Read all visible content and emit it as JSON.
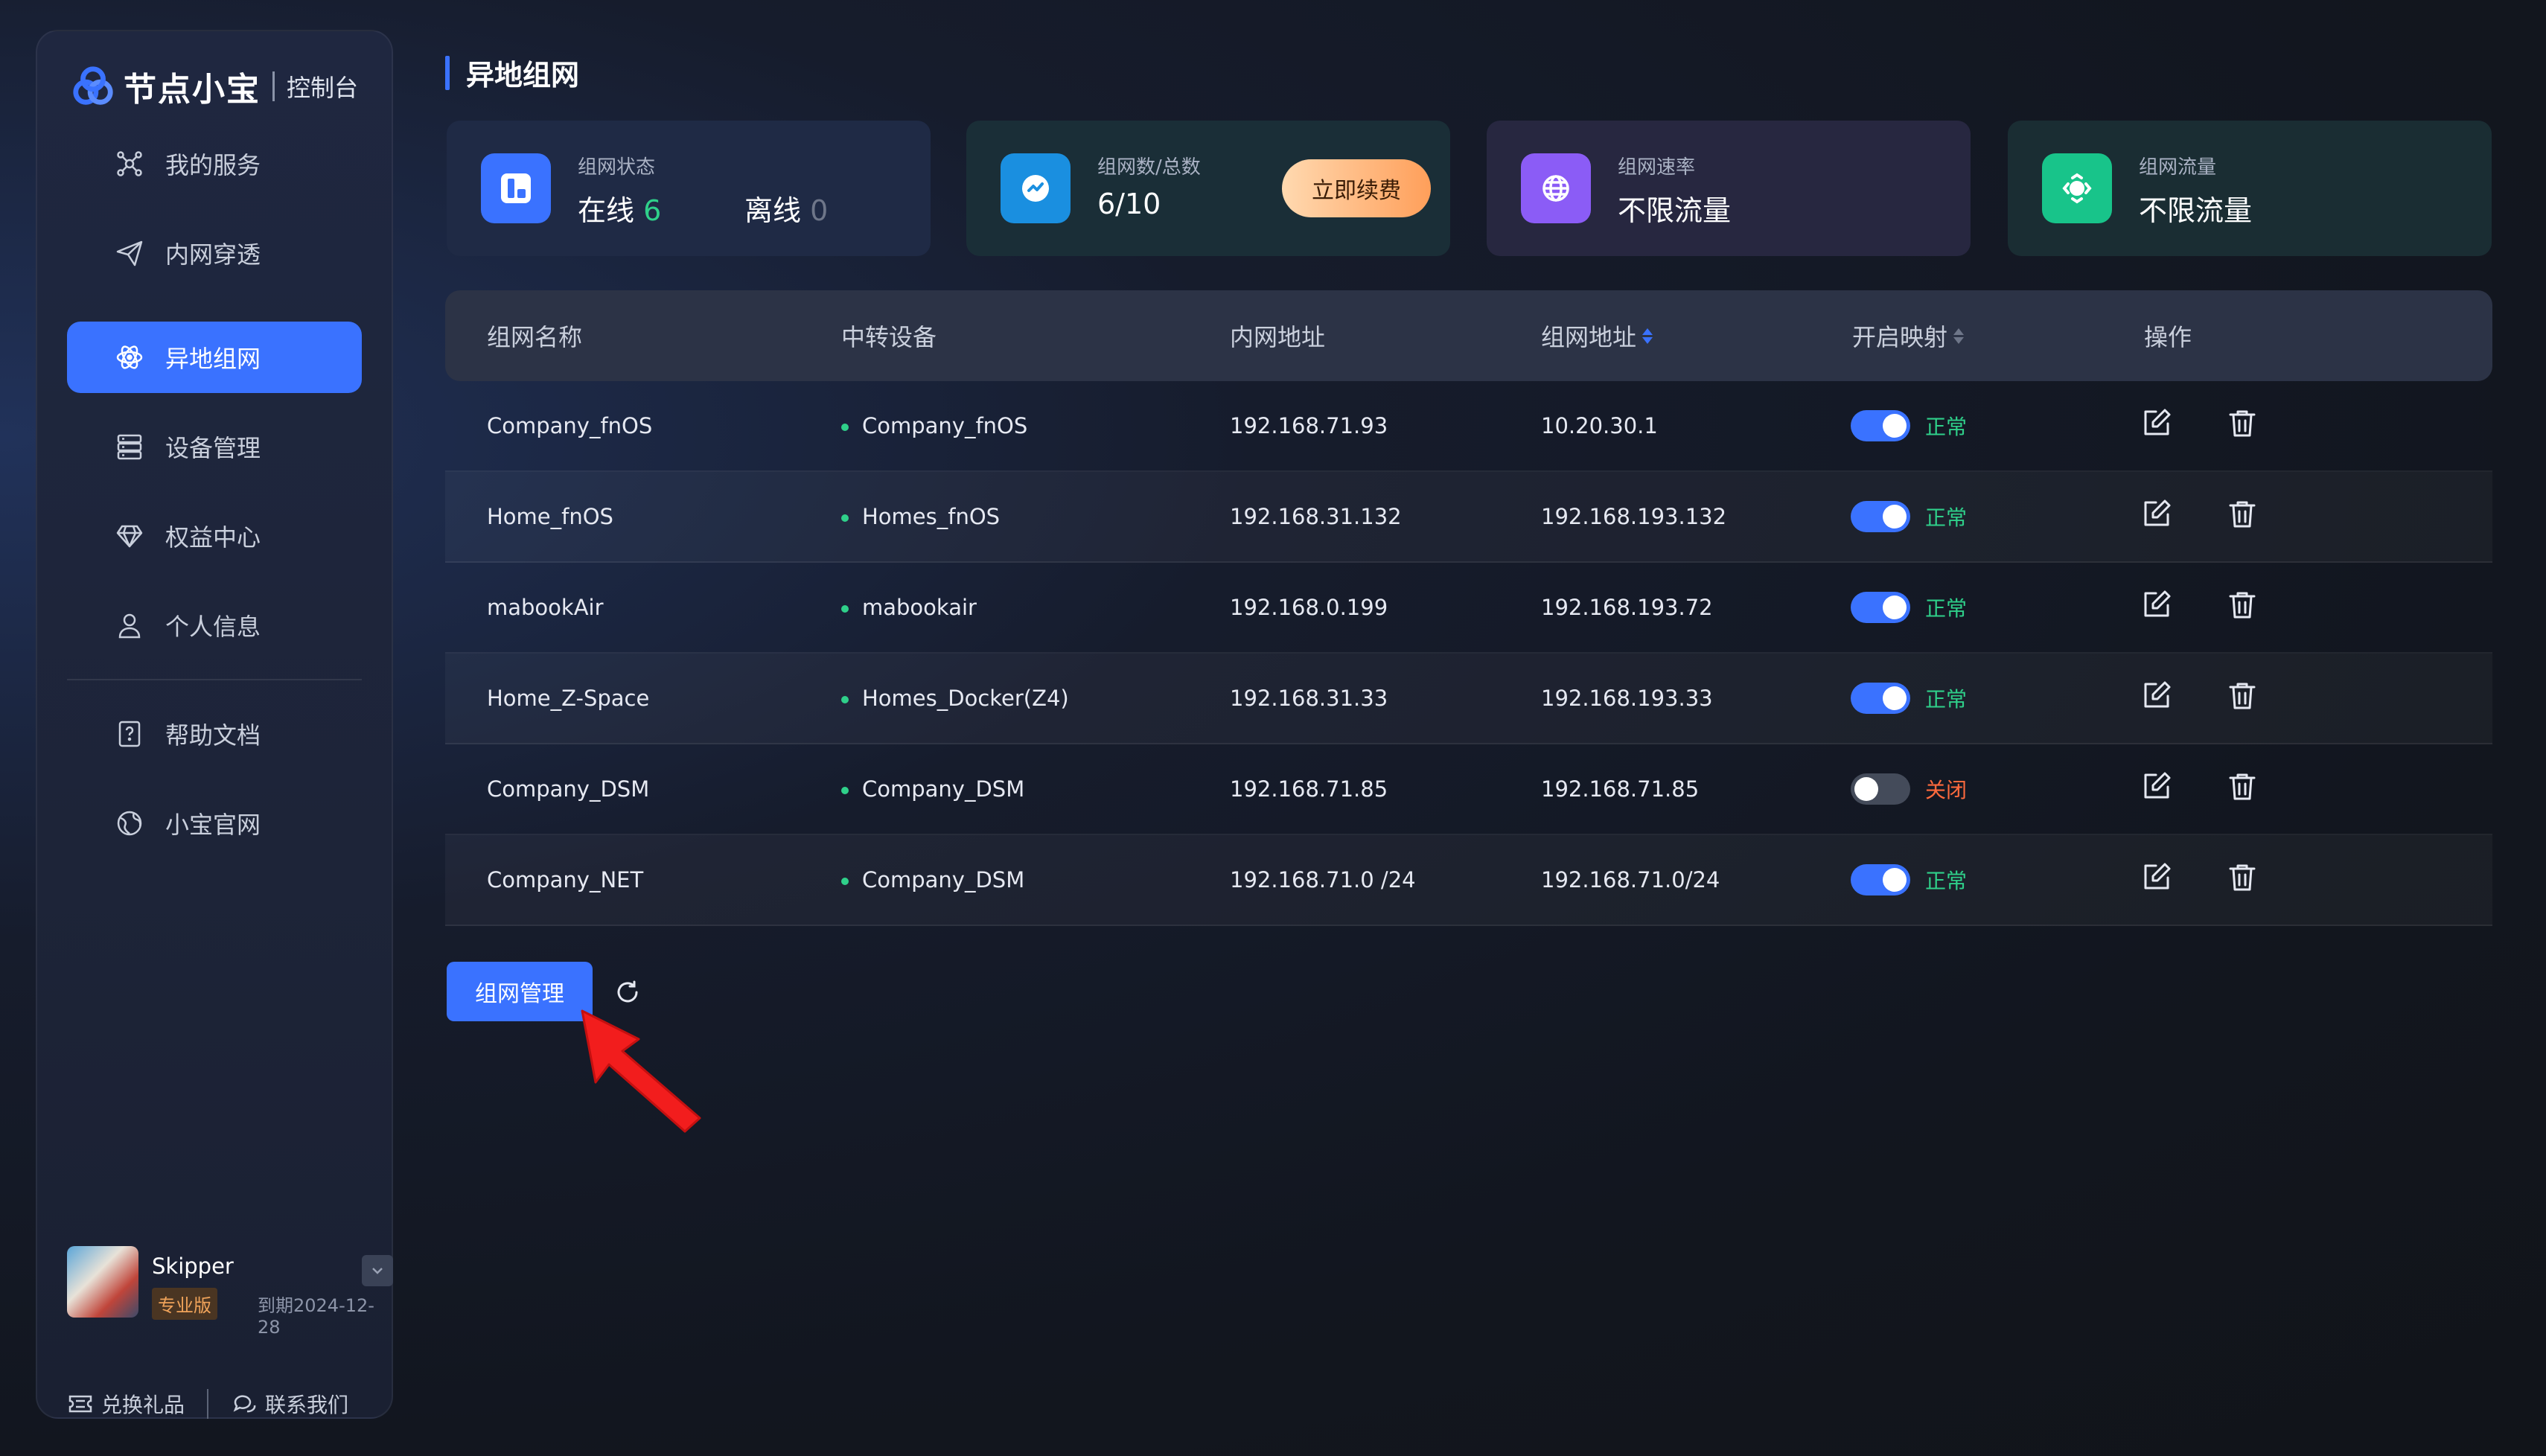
{
  "app": {
    "brand": "节点小宝",
    "console": "控制台"
  },
  "sidebar": {
    "items": [
      {
        "label": "我的服务",
        "icon": "network-nodes-icon"
      },
      {
        "label": "内网穿透",
        "icon": "paper-plane-icon"
      },
      {
        "label": "异地组网",
        "icon": "atom-icon",
        "active": true
      },
      {
        "label": "设备管理",
        "icon": "server-icon"
      },
      {
        "label": "权益中心",
        "icon": "diamond-icon"
      },
      {
        "label": "个人信息",
        "icon": "user-icon"
      }
    ],
    "secondary": [
      {
        "label": "帮助文档",
        "icon": "help-doc-icon"
      },
      {
        "label": "小宝官网",
        "icon": "globe-icon"
      }
    ]
  },
  "user": {
    "name": "Skipper",
    "plan": "专业版",
    "expire": "到期2024-12-28"
  },
  "footer": {
    "redeem": "兑换礼品",
    "contact": "联系我们"
  },
  "page": {
    "title": "异地组网"
  },
  "cards": [
    {
      "label": "组网状态",
      "online_label": "在线",
      "online_value": "6",
      "offline_label": "离线",
      "offline_value": "0",
      "color": "#3a72ff"
    },
    {
      "label": "组网数/总数",
      "value": "6/10",
      "button": "立即续费",
      "color": "#1a8fe0"
    },
    {
      "label": "组网速率",
      "value": "不限流量",
      "color": "#8b5cf6"
    },
    {
      "label": "组网流量",
      "value": "不限流量",
      "color": "#18c48a"
    }
  ],
  "table": {
    "columns": [
      "组网名称",
      "中转设备",
      "内网地址",
      "组网地址",
      "开启映射",
      "操作"
    ],
    "rows": [
      {
        "name": "Company_fnOS",
        "device": "Company_fnOS",
        "lan": "192.168.71.93",
        "net": "10.20.30.1",
        "on": true,
        "status": "正常"
      },
      {
        "name": "Home_fnOS",
        "device": "Homes_fnOS",
        "lan": "192.168.31.132",
        "net": "192.168.193.132",
        "on": true,
        "status": "正常"
      },
      {
        "name": "mabookAir",
        "device": "mabookair",
        "lan": "192.168.0.199",
        "net": "192.168.193.72",
        "on": true,
        "status": "正常"
      },
      {
        "name": "Home_Z-Space",
        "device": "Homes_Docker(Z4)",
        "lan": "192.168.31.33",
        "net": "192.168.193.33",
        "on": true,
        "status": "正常"
      },
      {
        "name": "Company_DSM",
        "device": "Company_DSM",
        "lan": "192.168.71.85",
        "net": "192.168.71.85",
        "on": false,
        "status": "关闭"
      },
      {
        "name": "Company_NET",
        "device": "Company_DSM",
        "lan": "192.168.71.0 /24",
        "net": "192.168.71.0/24",
        "on": true,
        "status": "正常"
      }
    ]
  },
  "actions": {
    "manage": "组网管理"
  },
  "colors": {
    "accent": "#3a72ff",
    "ok": "#2fd08a",
    "off": "#ff6a3d"
  }
}
